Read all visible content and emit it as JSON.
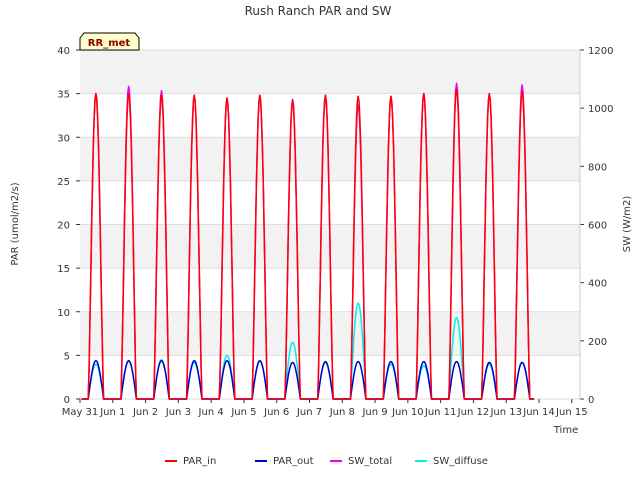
{
  "chart_data": {
    "type": "line",
    "title": "Rush Ranch PAR and SW",
    "site_label": "RR_met",
    "xlabel": "Time",
    "ylabel_left": "PAR (umol/m2/s)",
    "ylabel_right": "SW (W/m2)",
    "xlim": [
      0,
      15.25
    ],
    "ylim_left": [
      0,
      40
    ],
    "ylim_right": [
      0,
      1200
    ],
    "x_ticks": [
      0,
      1,
      2,
      3,
      4,
      5,
      6,
      7,
      8,
      9,
      10,
      11,
      12,
      13,
      14,
      15
    ],
    "x_tick_labels": [
      "May 31",
      "Jun 1",
      "Jun 2",
      "Jun 3",
      "Jun 4",
      "Jun 5",
      "Jun 6",
      "Jun 7",
      "Jun 8",
      "Jun 9",
      "Jun 10",
      "Jun 11",
      "Jun 12",
      "Jun 13",
      "Jun 14",
      "Jun 15"
    ],
    "y_left_ticks": [
      0,
      5,
      10,
      15,
      20,
      25,
      30,
      35,
      40
    ],
    "y_right_ticks": [
      0,
      200,
      400,
      600,
      800,
      1000,
      1200
    ],
    "grid": true,
    "legend_position": "bottom-center",
    "series": [
      {
        "name": "PAR_in",
        "color": "#ff0000",
        "axis": "left",
        "daily_peaks": [
          35.0,
          35.0,
          34.8,
          34.8,
          34.5,
          34.8,
          34.2,
          34.8,
          34.7,
          34.7,
          35.0,
          35.5,
          35.0,
          35.2
        ]
      },
      {
        "name": "PAR_out",
        "color": "#0000cc",
        "axis": "left",
        "daily_peaks": [
          4.4,
          4.4,
          4.4,
          4.4,
          4.4,
          4.4,
          4.2,
          4.3,
          4.3,
          4.3,
          4.3,
          4.3,
          4.2,
          4.2
        ]
      },
      {
        "name": "SW_total",
        "color": "#ee00ee",
        "axis": "right",
        "daily_peaks": [
          1050,
          1075,
          1060,
          1045,
          1035,
          1045,
          1030,
          1045,
          1010,
          1040,
          1050,
          1085,
          1050,
          1080
        ]
      },
      {
        "name": "SW_diffuse",
        "color": "#00eeee",
        "axis": "right",
        "daily_peaks": [
          120,
          130,
          135,
          125,
          150,
          130,
          195,
          125,
          330,
          120,
          115,
          280,
          120,
          125
        ]
      }
    ],
    "day_starts": [
      0,
      1,
      2,
      3,
      4,
      5,
      6,
      7,
      8,
      9,
      10,
      11,
      12,
      13
    ]
  }
}
